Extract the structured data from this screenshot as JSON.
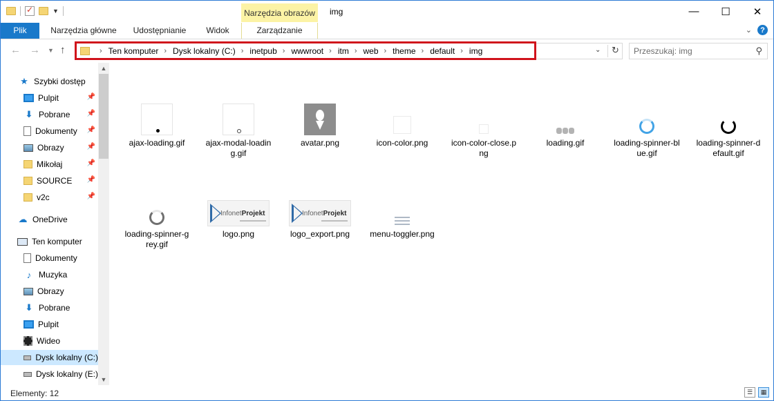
{
  "title_bar": {
    "window_title": "img",
    "contextual_group": "Narzędzia obrazów",
    "controls": {
      "minimize": "—",
      "maximize": "☐",
      "close": "✕"
    }
  },
  "ribbon": {
    "file_tab": "Plik",
    "tabs": [
      "Narzędzia główne",
      "Udostępnianie",
      "Widok"
    ],
    "contextual_tab": "Zarządzanie",
    "help": "?"
  },
  "address_bar": {
    "crumbs": [
      "Ten komputer",
      "Dysk lokalny (C:)",
      "inetpub",
      "wwwroot",
      "itm",
      "web",
      "theme",
      "default",
      "img"
    ]
  },
  "search": {
    "placeholder": "Przeszukaj: img"
  },
  "sidebar": {
    "quick_access_label": "Szybki dostęp",
    "quick_access": [
      "Pulpit",
      "Pobrane",
      "Dokumenty",
      "Obrazy",
      "Mikołaj",
      "SOURCE",
      "v2c"
    ],
    "onedrive": "OneDrive",
    "this_pc_label": "Ten komputer",
    "this_pc": [
      "Dokumenty",
      "Muzyka",
      "Obrazy",
      "Pobrane",
      "Pulpit",
      "Wideo",
      "Dysk lokalny (C:)",
      "Dysk lokalny (E:)"
    ]
  },
  "files": [
    "ajax-loading.gif",
    "ajax-modal-loading.gif",
    "avatar.png",
    "icon-color.png",
    "icon-color-close.png",
    "loading.gif",
    "loading-spinner-blue.gif",
    "loading-spinner-default.gif",
    "loading-spinner-grey.gif",
    "logo.png",
    "logo_export.png",
    "menu-toggler.png"
  ],
  "logo_text": {
    "light": "Infonet",
    "bold": "Projekt"
  },
  "status_bar": {
    "items_count": "Elementy: 12"
  }
}
